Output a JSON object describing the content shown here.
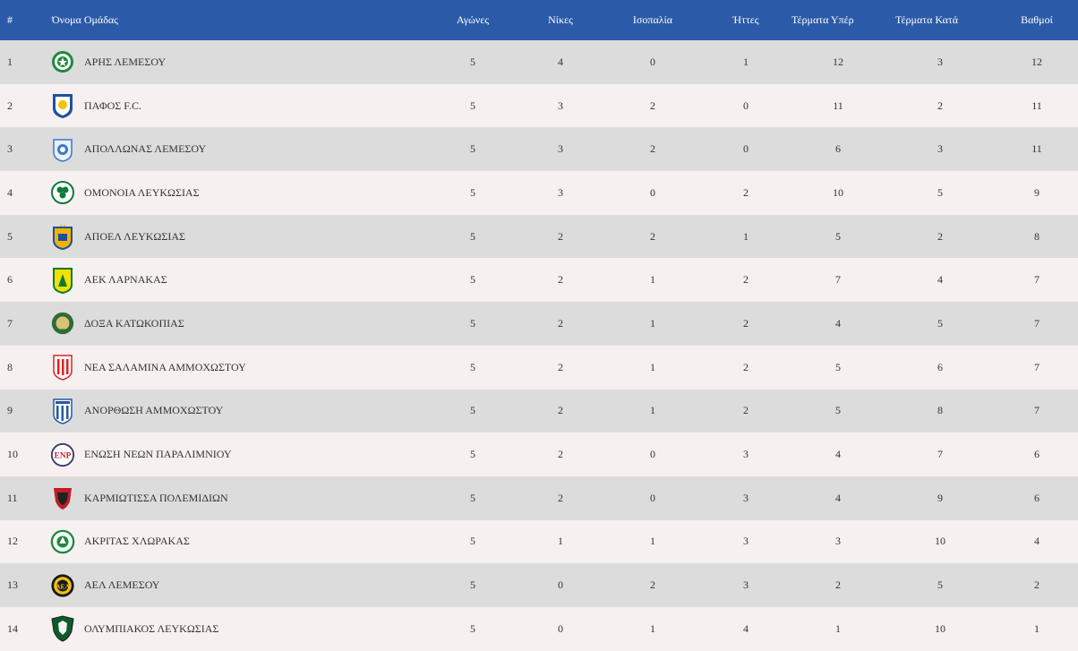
{
  "header": {
    "pos": "#",
    "team": "Όνομα Ομάδας",
    "played": "Αγώνες",
    "wins": "Νίκες",
    "draws": "Ισοπαλία",
    "losses": "Ήττες",
    "goals_for": "Τέρματα Υπέρ",
    "goals_against": "Τέρματα Κατά",
    "points": "Βαθμοί"
  },
  "colors": {
    "header_bg": "#2b5ba8",
    "row_odd": "#dcdcdc",
    "row_even": "#f7f0f0"
  },
  "rows": [
    {
      "pos": "1",
      "team": "ΑΡΗΣ ΛΕΜΕΣΟΥ",
      "played": "5",
      "wins": "4",
      "draws": "0",
      "losses": "1",
      "gf": "12",
      "ga": "3",
      "pts": "12",
      "logo": "aris-limassol-crest-icon"
    },
    {
      "pos": "2",
      "team": "ΠΑΦΟΣ F.C.",
      "played": "5",
      "wins": "3",
      "draws": "2",
      "losses": "0",
      "gf": "11",
      "ga": "2",
      "pts": "11",
      "logo": "pafos-fc-crest-icon"
    },
    {
      "pos": "3",
      "team": "ΑΠΟΛΛΩΝΑΣ ΛΕΜΕΣΟΥ",
      "played": "5",
      "wins": "3",
      "draws": "2",
      "losses": "0",
      "gf": "6",
      "ga": "3",
      "pts": "11",
      "logo": "apollon-limassol-crest-icon"
    },
    {
      "pos": "4",
      "team": "ΟΜΟΝΟΙΑ ΛΕΥΚΩΣΙΑΣ",
      "played": "5",
      "wins": "3",
      "draws": "0",
      "losses": "2",
      "gf": "10",
      "ga": "5",
      "pts": "9",
      "logo": "omonoia-crest-icon"
    },
    {
      "pos": "5",
      "team": "ΑΠΟΕΛ ΛΕΥΚΩΣΙΑΣ",
      "played": "5",
      "wins": "2",
      "draws": "2",
      "losses": "1",
      "gf": "5",
      "ga": "2",
      "pts": "8",
      "logo": "apoel-crest-icon"
    },
    {
      "pos": "6",
      "team": "ΑΕΚ ΛΑΡΝΑΚΑΣ",
      "played": "5",
      "wins": "2",
      "draws": "1",
      "losses": "2",
      "gf": "7",
      "ga": "4",
      "pts": "7",
      "logo": "aek-larnaca-crest-icon"
    },
    {
      "pos": "7",
      "team": "ΔΟΞΑ ΚΑΤΩΚΟΠΙΑΣ",
      "played": "5",
      "wins": "2",
      "draws": "1",
      "losses": "2",
      "gf": "4",
      "ga": "5",
      "pts": "7",
      "logo": "doxa-katokopias-crest-icon"
    },
    {
      "pos": "8",
      "team": "ΝΕΑ ΣΑΛΑΜΙΝΑ ΑΜΜΟΧΩΣΤΟΥ",
      "played": "5",
      "wins": "2",
      "draws": "1",
      "losses": "2",
      "gf": "5",
      "ga": "6",
      "pts": "7",
      "logo": "nea-salamina-crest-icon"
    },
    {
      "pos": "9",
      "team": "ΑΝΟΡΘΩΣΗ ΑΜΜΟΧΩΣΤΟΥ",
      "played": "5",
      "wins": "2",
      "draws": "1",
      "losses": "2",
      "gf": "5",
      "ga": "8",
      "pts": "7",
      "logo": "anorthosis-crest-icon"
    },
    {
      "pos": "10",
      "team": "ΕΝΩΣΗ ΝΕΩΝ ΠΑΡΑΛΙΜΝΙΟΥ",
      "played": "5",
      "wins": "2",
      "draws": "0",
      "losses": "3",
      "gf": "4",
      "ga": "7",
      "pts": "6",
      "logo": "enp-crest-icon"
    },
    {
      "pos": "11",
      "team": "ΚΑΡΜΙΩΤΙΣΣΑ ΠΟΛΕΜΙΔΙΩΝ",
      "played": "5",
      "wins": "2",
      "draws": "0",
      "losses": "3",
      "gf": "4",
      "ga": "9",
      "pts": "6",
      "logo": "karmiotissa-crest-icon"
    },
    {
      "pos": "12",
      "team": "ΑΚΡΙΤΑΣ ΧΛΩΡΑΚΑΣ",
      "played": "5",
      "wins": "1",
      "draws": "1",
      "losses": "3",
      "gf": "3",
      "ga": "10",
      "pts": "4",
      "logo": "akritas-chlorakas-crest-icon"
    },
    {
      "pos": "13",
      "team": "ΑΕΛ ΛΕΜΕΣΟΥ",
      "played": "5",
      "wins": "0",
      "draws": "2",
      "losses": "3",
      "gf": "2",
      "ga": "5",
      "pts": "2",
      "logo": "ael-limassol-crest-icon"
    },
    {
      "pos": "14",
      "team": "ΟΛΥΜΠΙΑΚΟΣ ΛΕΥΚΩΣΙΑΣ",
      "played": "5",
      "wins": "0",
      "draws": "1",
      "losses": "4",
      "gf": "1",
      "ga": "10",
      "pts": "1",
      "logo": "olympiakos-nicosia-crest-icon"
    }
  ]
}
